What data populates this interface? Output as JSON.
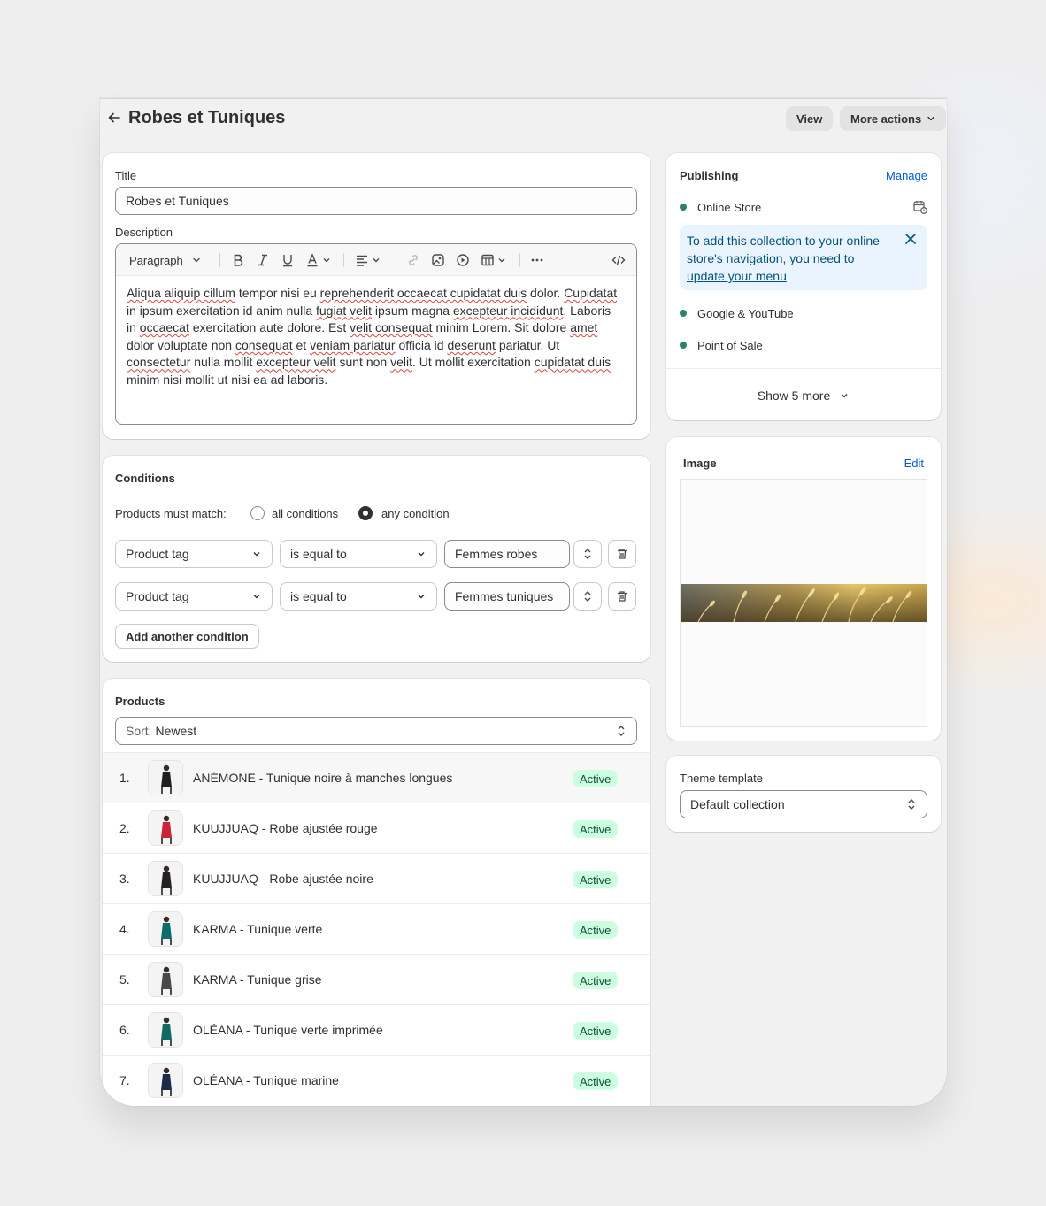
{
  "header": {
    "title": "Robes et Tuniques",
    "view_label": "View",
    "more_actions_label": "More actions"
  },
  "details": {
    "title_label": "Title",
    "title_value": "Robes et Tuniques",
    "description_label": "Description",
    "paragraph_style": "Paragraph",
    "description_text": [
      {
        "t": "Aliqua aliquip cillum",
        "sq": true
      },
      {
        "t": " tempor nisi eu ",
        "sq": false
      },
      {
        "t": "reprehenderit occaecat cupidatat duis",
        "sq": true
      },
      {
        "t": " dolor. ",
        "sq": false
      },
      {
        "t": "Cupidatat",
        "sq": true
      },
      {
        "t": " in ipsum exercitation id anim nulla ",
        "sq": false
      },
      {
        "t": "fugiat velit",
        "sq": true
      },
      {
        "t": " ipsum magna ",
        "sq": false
      },
      {
        "t": "excepteur incididunt",
        "sq": true
      },
      {
        "t": ". Laboris in ",
        "sq": false
      },
      {
        "t": "occaecat",
        "sq": true
      },
      {
        "t": " exercitation aute dolore. Est ",
        "sq": false
      },
      {
        "t": "velit consequat",
        "sq": true
      },
      {
        "t": " minim Lorem. Sit dolore ",
        "sq": false
      },
      {
        "t": "amet",
        "sq": true
      },
      {
        "t": " dolor voluptate non ",
        "sq": false
      },
      {
        "t": "consequat",
        "sq": true
      },
      {
        "t": " et ",
        "sq": false
      },
      {
        "t": "veniam pariatur",
        "sq": true
      },
      {
        "t": " officia id ",
        "sq": false
      },
      {
        "t": "deserunt",
        "sq": true
      },
      {
        "t": " pariatur. Ut ",
        "sq": false
      },
      {
        "t": "consectetur",
        "sq": true
      },
      {
        "t": " nulla mollit ",
        "sq": false
      },
      {
        "t": "excepteur velit",
        "sq": true
      },
      {
        "t": " sunt non ",
        "sq": false
      },
      {
        "t": "velit",
        "sq": true
      },
      {
        "t": ". Ut mollit exercitation ",
        "sq": false
      },
      {
        "t": "cupidatat duis",
        "sq": true
      },
      {
        "t": " minim nisi mollit ut nisi ea ad laboris.",
        "sq": false
      }
    ]
  },
  "conditions": {
    "heading": "Conditions",
    "match_label": "Products must match:",
    "option_all": "all conditions",
    "option_any": "any condition",
    "selected": "any condition",
    "rules": [
      {
        "field": "Product tag",
        "operator": "is equal to",
        "value": "Femmes robes"
      },
      {
        "field": "Product tag",
        "operator": "is equal to",
        "value": "Femmes tuniques"
      }
    ],
    "add_label": "Add another condition"
  },
  "products": {
    "heading": "Products",
    "sort_prefix": "Sort:",
    "sort_value": "Newest",
    "items": [
      {
        "num": "1.",
        "name": "ANÉMONE - Tunique noire à manches longues",
        "status": "Active",
        "color": "#1f1f1f"
      },
      {
        "num": "2.",
        "name": "KUUJJUAQ - Robe ajustée rouge",
        "status": "Active",
        "color": "#c8243a"
      },
      {
        "num": "3.",
        "name": "KUUJJUAQ - Robe ajustée noire",
        "status": "Active",
        "color": "#222222"
      },
      {
        "num": "4.",
        "name": "KARMA - Tunique verte",
        "status": "Active",
        "color": "#0e6d6a"
      },
      {
        "num": "5.",
        "name": "KARMA - Tunique grise",
        "status": "Active",
        "color": "#4a4a4a"
      },
      {
        "num": "6.",
        "name": "OLÉANA - Tunique verte imprimée",
        "status": "Active",
        "color": "#126b63"
      },
      {
        "num": "7.",
        "name": "OLÉANA - Tunique marine",
        "status": "Active",
        "color": "#1e2a4a"
      }
    ]
  },
  "publishing": {
    "heading": "Publishing",
    "manage_label": "Manage",
    "channels": [
      "Online Store",
      "Google & YouTube",
      "Point of Sale"
    ],
    "banner_text": "To add this collection to your online store's navigation, you need to",
    "banner_link": "update your menu",
    "show_more": "Show 5 more"
  },
  "image_card": {
    "heading": "Image",
    "edit_label": "Edit"
  },
  "theme": {
    "label": "Theme template",
    "value": "Default collection"
  }
}
